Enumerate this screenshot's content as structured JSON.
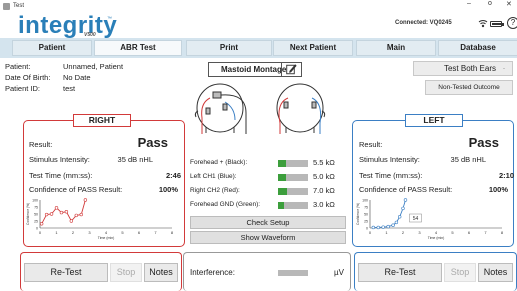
{
  "window": {
    "title": "Test",
    "minimize": "–",
    "maximize": "o",
    "close": "✕"
  },
  "header": {
    "logo": "integrity",
    "logo_tm": "™",
    "logo_sub": "V500",
    "connection_status": "Connected: VQ0245",
    "help": "?"
  },
  "tabs": [
    {
      "label": "Patient"
    },
    {
      "label": "ABR Test"
    },
    {
      "label": "Print"
    },
    {
      "label": "Next Patient"
    },
    {
      "label": "Main"
    },
    {
      "label": "Database"
    }
  ],
  "patient": {
    "name_label": "Patient:",
    "name": "Unnamed, Patient",
    "dob_label": "Date Of Birth:",
    "dob": "No Date",
    "id_label": "Patient ID:",
    "id": "test"
  },
  "montage_button": "Mastoid Montage",
  "test_both_button": "Test Both Ears",
  "test_both_arrow": "-",
  "nontested_button": "Non-Tested Outcome",
  "right_ear": {
    "label": "RIGHT",
    "result_label": "Result:",
    "result": "Pass",
    "intensity_label": "Stimulus Intensity:",
    "intensity": "35 dB nHL",
    "time_label": "Test Time (mm:ss):",
    "time": "2:46",
    "confidence_label": "Confidence of PASS Result:",
    "confidence": "100%",
    "retest": "Re-Test",
    "stop": "Stop",
    "notes": "Notes"
  },
  "left_ear": {
    "label": "LEFT",
    "result_label": "Result:",
    "result": "Pass",
    "intensity_label": "Stimulus Intensity:",
    "intensity": "35 dB nHL",
    "time_label": "Test Time (mm:ss):",
    "time": "2:10",
    "confidence_label": "Confidence of PASS Result:",
    "confidence": "100%",
    "chart_annotation": "54",
    "retest": "Re-Test",
    "stop": "Stop",
    "notes": "Notes"
  },
  "electrodes": [
    {
      "label": "Forehead + (Black):",
      "value": "5.5 kΩ",
      "level": 0.25
    },
    {
      "label": "Left CH1 (Blue):",
      "value": "5.0 kΩ",
      "level": 0.25
    },
    {
      "label": "Right CH2 (Red):",
      "value": "7.0 kΩ",
      "level": 0.3
    },
    {
      "label": "Forehead GND (Green):",
      "value": "3.0 kΩ",
      "level": 0.2
    }
  ],
  "check_setup": "Check Setup",
  "show_waveform": "Show Waveform",
  "interference_label": "Interference:",
  "interference_unit": "µV",
  "colors": {
    "right": "#d23a3a",
    "left": "#3b7fc4",
    "accent": "#2a7fb8",
    "good": "#3c9e3c"
  },
  "chart_data": [
    {
      "type": "line",
      "ear": "right",
      "xlabel": "Time (min)",
      "ylabel": "Confidence (%)",
      "xlim": [
        0,
        8
      ],
      "ylim": [
        0,
        100
      ],
      "xticks": [
        "0",
        "1",
        "2",
        "3",
        "4",
        "5",
        "6",
        "7",
        "8"
      ],
      "yticks": [
        "100",
        "75",
        "50",
        "25",
        "0"
      ],
      "x": [
        0.1,
        0.4,
        0.7,
        1.0,
        1.3,
        1.6,
        1.9,
        2.2,
        2.5,
        2.75
      ],
      "y": [
        15,
        48,
        50,
        72,
        55,
        58,
        25,
        45,
        48,
        100
      ],
      "color": "#d23a3a"
    },
    {
      "type": "line",
      "ear": "left",
      "xlabel": "Time (min)",
      "ylabel": "Confidence (%)",
      "xlim": [
        0,
        8
      ],
      "ylim": [
        0,
        100
      ],
      "xticks": [
        "0",
        "1",
        "2",
        "3",
        "4",
        "5",
        "6",
        "7",
        "8"
      ],
      "yticks": [
        "100",
        "75",
        "50",
        "25",
        "0"
      ],
      "x": [
        0.2,
        0.5,
        0.8,
        1.1,
        1.4,
        1.6,
        1.8,
        2.0,
        2.15
      ],
      "y": [
        2,
        2,
        3,
        5,
        10,
        20,
        40,
        70,
        100
      ],
      "color": "#3b7fc4"
    }
  ]
}
